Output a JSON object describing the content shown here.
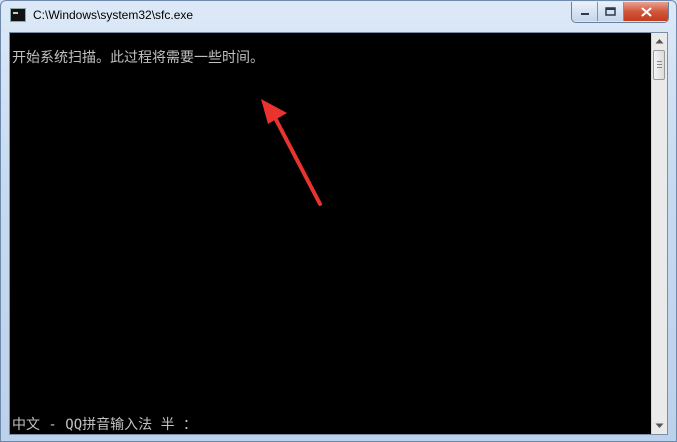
{
  "window": {
    "title": "C:\\Windows\\system32\\sfc.exe",
    "icon": "console-icon"
  },
  "caption_buttons": [
    "minimize-icon",
    "maximize-icon",
    "close-icon"
  ],
  "console": {
    "lines": [
      "开始系统扫描。此过程将需要一些时间。"
    ],
    "ime_status": "中文 - QQ拼音输入法 半 ：",
    "text_color": "#c0c0c0",
    "background": "#000000"
  },
  "annotation": {
    "color": "#e8332e",
    "icon": "red-arrow-annotation"
  }
}
